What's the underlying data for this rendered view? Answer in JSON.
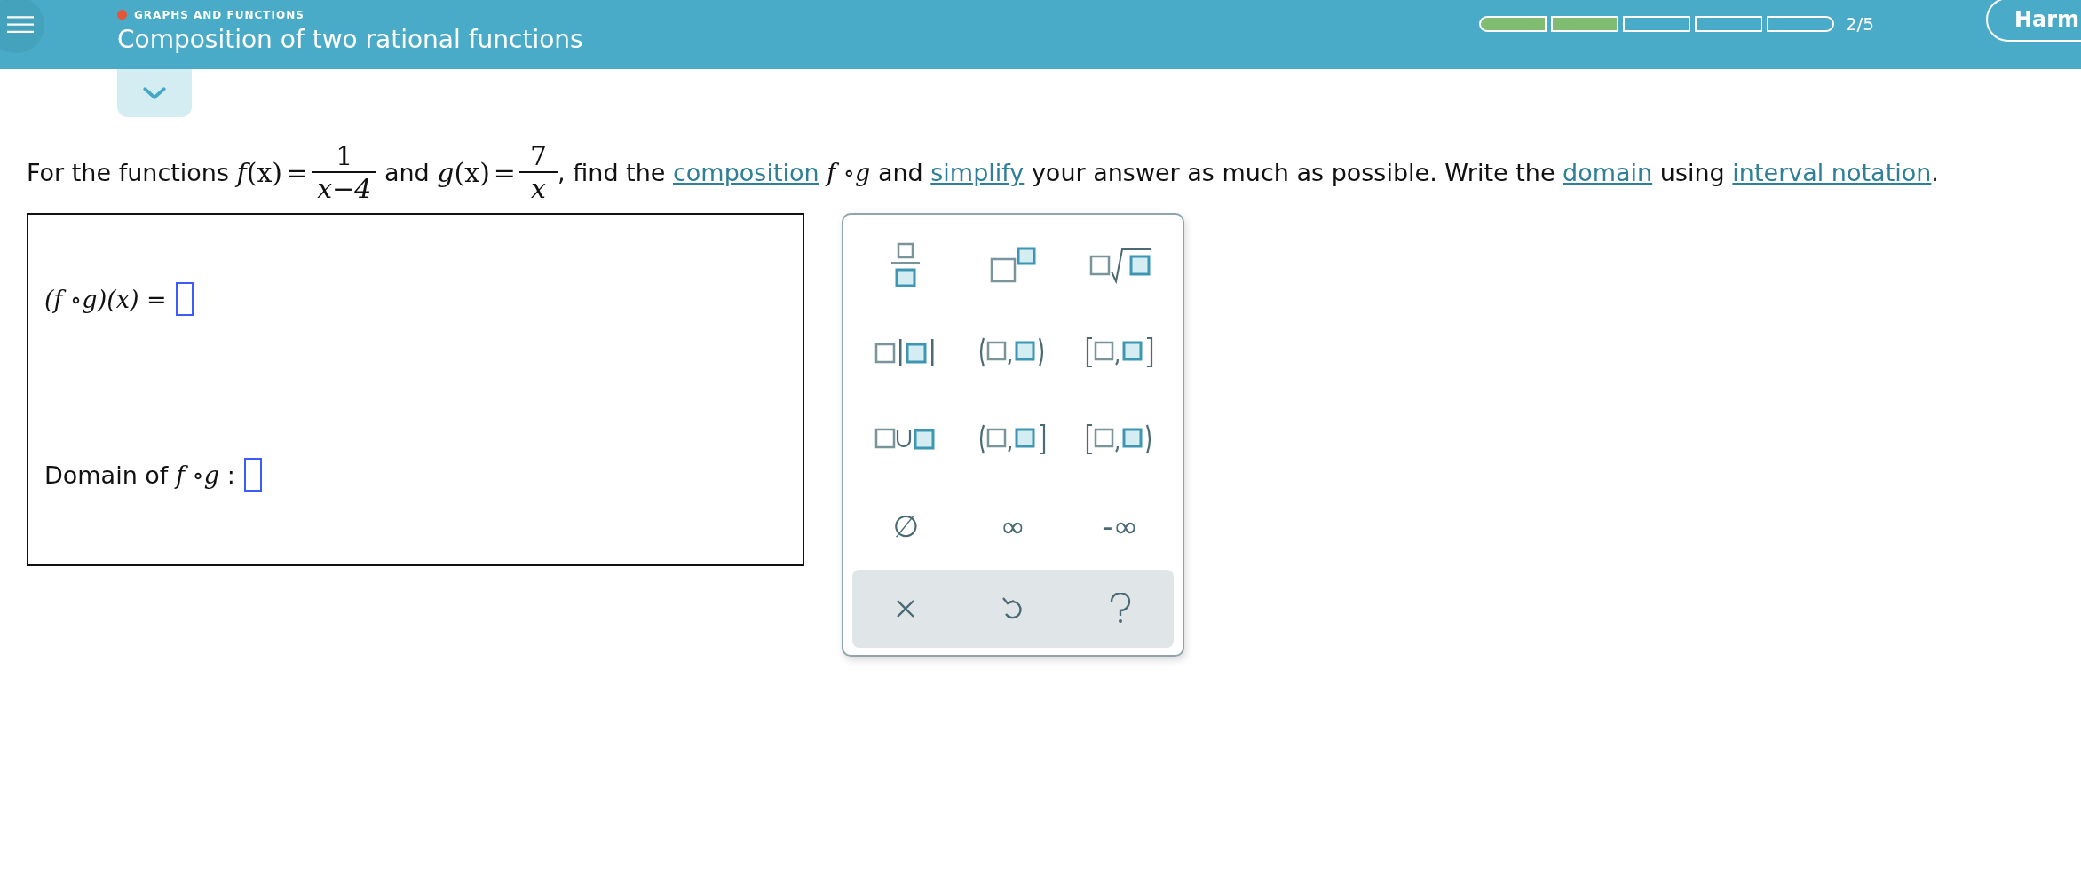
{
  "header": {
    "topic": "GRAPHS AND FUNCTIONS",
    "title": "Composition of two rational functions",
    "progress": {
      "segments": [
        {
          "filled": true
        },
        {
          "filled": true
        },
        {
          "filled": false
        },
        {
          "filled": false
        },
        {
          "filled": false
        }
      ],
      "count": "2/5"
    },
    "user_button": "Harm"
  },
  "problem": [
    {
      "kind": "text",
      "text": "For the functions "
    },
    {
      "kind": "function",
      "name": "f",
      "arg": "(x)",
      "equals": "=",
      "numerator": "1",
      "denominator": "x−4"
    },
    {
      "kind": "text",
      "text": " and "
    },
    {
      "kind": "function",
      "name": "g",
      "arg": "(x)",
      "equals": "=",
      "numerator": "7",
      "denominator": "x"
    },
    {
      "kind": "text",
      "text": ", find the "
    },
    {
      "kind": "link",
      "text": "composition"
    },
    {
      "kind": "math",
      "text": " f ∘g"
    },
    {
      "kind": "text",
      "text": " and "
    },
    {
      "kind": "link",
      "text": "simplify"
    },
    {
      "kind": "text",
      "text": " your answer as much as possible. Write the "
    },
    {
      "kind": "link",
      "text": "domain"
    },
    {
      "kind": "text",
      "text": " using "
    },
    {
      "kind": "link",
      "text": "interval notation"
    },
    {
      "kind": "text",
      "text": "."
    }
  ],
  "answers": [
    {
      "kind": "math",
      "label": "(f ∘g)(x)",
      "suffix": "="
    },
    {
      "kind": "domain",
      "label": "Domain of",
      "math": "f ∘g",
      "suffix": ":"
    }
  ],
  "keypad": {
    "keys": [
      {
        "kind": "fraction"
      },
      {
        "kind": "superscript"
      },
      {
        "kind": "root"
      },
      {
        "kind": "absolute"
      },
      {
        "kind": "open-interval"
      },
      {
        "kind": "closed-interval"
      },
      {
        "kind": "union"
      },
      {
        "kind": "left-open-interval"
      },
      {
        "kind": "right-open-interval"
      },
      {
        "kind": "symbol",
        "symbol": "∅"
      },
      {
        "kind": "symbol",
        "symbol": "∞"
      },
      {
        "kind": "symbol",
        "symbol": "-∞"
      }
    ],
    "actions": [
      {
        "kind": "clear"
      },
      {
        "kind": "undo"
      },
      {
        "kind": "help"
      }
    ]
  }
}
